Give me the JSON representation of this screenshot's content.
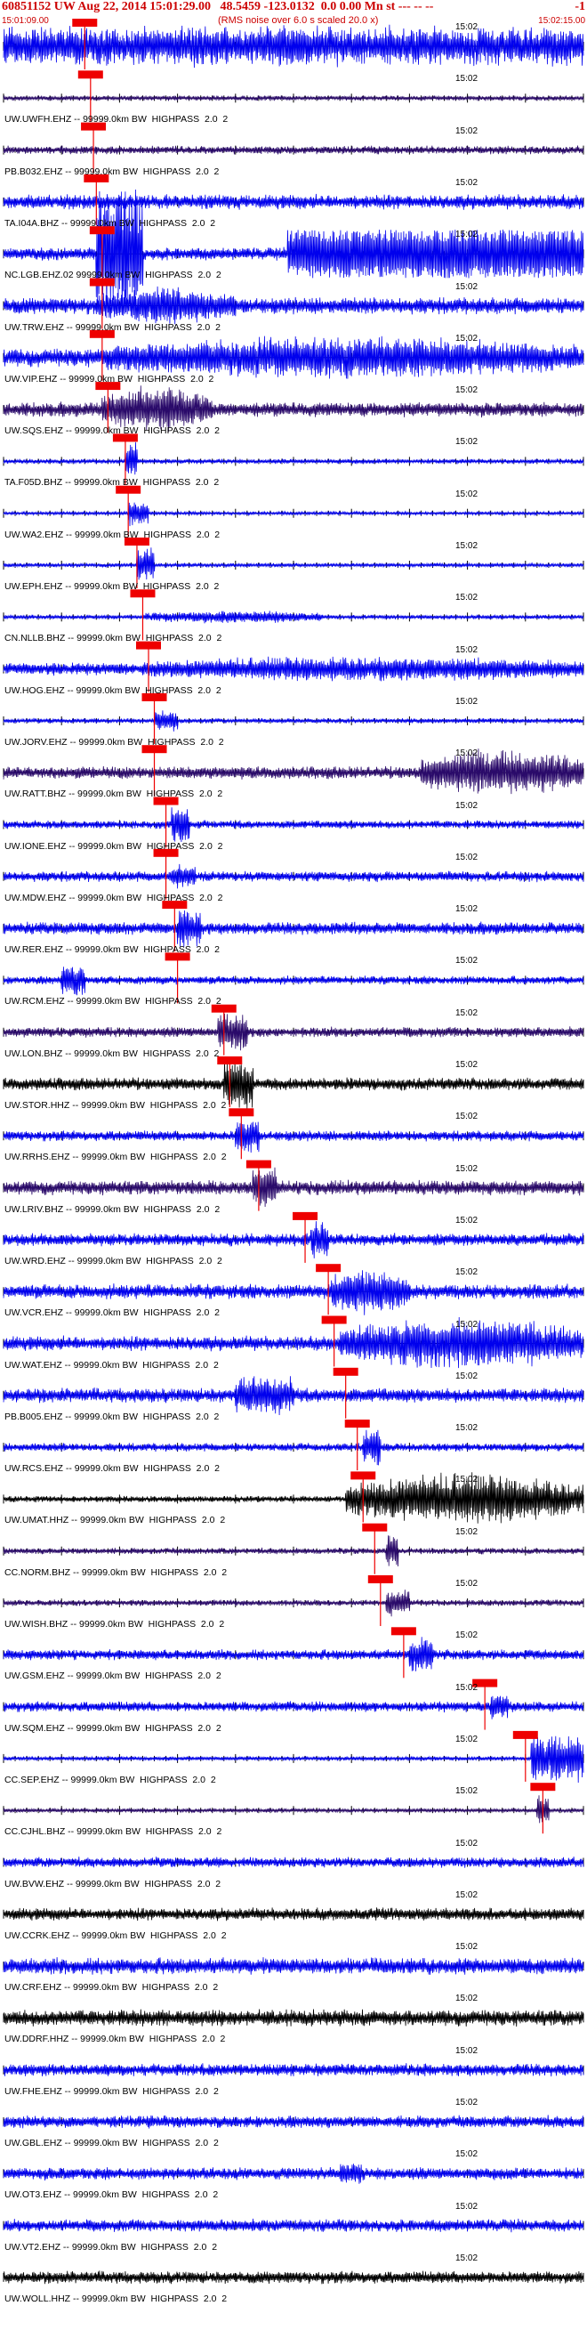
{
  "header": {
    "title": "60851152 UW Aug 22, 2014 15:01:29.00   48.5459 -123.0132  0.0 0.00 Mn st --- -- --",
    "event_suffix": "-1",
    "subtitle": "(RMS noise over 6.0 s scaled 20.0 x)",
    "start_time": "15:01:09.00",
    "end_time": "15:02:15.00",
    "time_mark": "15:02"
  },
  "colors": {
    "header_text": "#cc0000",
    "blue_trace": "#0000ee",
    "purple_trace": "#2a0a6a",
    "black_trace": "#000000",
    "pick_box": "#ee0000",
    "axis": "#000000"
  },
  "chart_data": {
    "type": "line",
    "title": "60851152 UW Aug 22, 2014 15:01:29.00",
    "x_range": [
      "15:01:09.00",
      "15:02:15.00"
    ],
    "time_mark": "15:02",
    "series": [
      {
        "label": "",
        "color": "blue",
        "amp": 0.95,
        "pick": 0.14,
        "burst": [
          0.43,
          0.55,
          1.0
        ]
      },
      {
        "label": "UW.UWFH.EHZ -- 99999.0km BW  HIGHPASS  2.0  2",
        "color": "purple",
        "amp": 0.12,
        "pick": 0.15,
        "burst": null
      },
      {
        "label": "PB.B032.EHZ -- 99999.0km BW  HIGHPASS  2.0  2",
        "color": "purple",
        "amp": 0.2,
        "pick": 0.155,
        "burst": null
      },
      {
        "label": "TA.I04A.BHZ -- 99999.0km BW  HIGHPASS  2.0  2",
        "color": "blue",
        "amp": 0.35,
        "pick": 0.16,
        "burst": null
      },
      {
        "label": "NC.LGB.EHZ.02 99999.0km BW  HIGHPASS  2.0  2",
        "color": "blue",
        "amp": 0.3,
        "pick": 0.17,
        "burst": [
          0.16,
          0.24,
          3.0
        ],
        "clip": [
          0.49,
          1.0
        ]
      },
      {
        "label": "UW.TRW.EHZ -- 99999.0km BW  HIGHPASS  2.0  2",
        "color": "blue",
        "amp": 0.4,
        "pick": 0.17,
        "burst": [
          0.16,
          0.4,
          0.9
        ]
      },
      {
        "label": "UW.VIP.EHZ -- 99999.0km BW  HIGHPASS  2.0  2",
        "color": "blue",
        "amp": 0.45,
        "pick": 0.17,
        "burst": [
          0.17,
          1.0,
          1.0
        ]
      },
      {
        "label": "UW.SQS.EHZ -- 99999.0km BW  HIGHPASS  2.0  2",
        "color": "purple",
        "amp": 0.35,
        "pick": 0.18,
        "burst": [
          0.17,
          0.36,
          1.1
        ]
      },
      {
        "label": "TA.F05D.BHZ -- 99999.0km BW  HIGHPASS  2.0  2",
        "color": "blue",
        "amp": 0.12,
        "pick": 0.21,
        "burst": [
          0.21,
          0.23,
          0.9
        ]
      },
      {
        "label": "UW.WA2.EHZ -- 99999.0km BW  HIGHPASS  2.0  2",
        "color": "blue",
        "amp": 0.08,
        "pick": 0.215,
        "burst": [
          0.215,
          0.25,
          0.6
        ]
      },
      {
        "label": "UW.EPH.EHZ -- 99999.0km BW  HIGHPASS  2.0  2",
        "color": "blue",
        "amp": 0.1,
        "pick": 0.23,
        "burst": [
          0.23,
          0.26,
          0.8
        ]
      },
      {
        "label": "CN.NLLB.BHZ -- 99999.0km BW  HIGHPASS  2.0  2",
        "color": "blue",
        "amp": 0.1,
        "pick": 0.24,
        "burst": [
          0.24,
          0.55,
          0.3
        ]
      },
      {
        "label": "UW.HOG.EHZ -- 99999.0km BW  HIGHPASS  2.0  2",
        "color": "blue",
        "amp": 0.3,
        "pick": 0.25,
        "burst": [
          0.24,
          1.0,
          0.6
        ]
      },
      {
        "label": "UW.JORV.EHZ -- 99999.0km BW  HIGHPASS  2.0  2",
        "color": "blue",
        "amp": 0.12,
        "pick": 0.26,
        "burst": [
          0.26,
          0.3,
          0.5
        ]
      },
      {
        "label": "UW.RATT.BHZ -- 99999.0km BW  HIGHPASS  2.0  2",
        "color": "purple",
        "amp": 0.3,
        "pick": 0.26,
        "burst": [
          0.72,
          1.0,
          1.1
        ]
      },
      {
        "label": "UW.IONE.EHZ -- 99999.0km BW  HIGHPASS  2.0  2",
        "color": "blue",
        "amp": 0.2,
        "pick": 0.28,
        "burst": [
          0.29,
          0.32,
          0.9
        ]
      },
      {
        "label": "UW.MDW.EHZ -- 99999.0km BW  HIGHPASS  2.0  2",
        "color": "blue",
        "amp": 0.25,
        "pick": 0.28,
        "burst": [
          0.29,
          0.33,
          0.6
        ]
      },
      {
        "label": "UW.RER.EHZ -- 99999.0km BW  HIGHPASS  2.0  2",
        "color": "blue",
        "amp": 0.3,
        "pick": 0.295,
        "burst": [
          0.3,
          0.34,
          0.9
        ]
      },
      {
        "label": "UW.RCM.EHZ -- 99999.0km BW  HIGHPASS  2.0  2",
        "color": "blue",
        "amp": 0.2,
        "pick": 0.3,
        "burst": [
          0.1,
          0.14,
          0.8
        ]
      },
      {
        "label": "UW.LON.BHZ -- 99999.0km BW  HIGHPASS  2.0  2",
        "color": "purple",
        "amp": 0.25,
        "pick": 0.38,
        "burst": [
          0.37,
          0.42,
          0.9
        ]
      },
      {
        "label": "UW.STOR.HHZ -- 99999.0km BW  HIGHPASS  2.0  2",
        "color": "black",
        "amp": 0.3,
        "pick": 0.39,
        "burst": [
          0.38,
          0.43,
          1.2
        ]
      },
      {
        "label": "UW.RRHS.EHZ -- 99999.0km BW  HIGHPASS  2.0  2",
        "color": "blue",
        "amp": 0.25,
        "pick": 0.41,
        "burst": [
          0.4,
          0.44,
          0.9
        ]
      },
      {
        "label": "UW.LRIV.BHZ -- 99999.0km BW  HIGHPASS  2.0  2",
        "color": "purple",
        "amp": 0.35,
        "pick": 0.44,
        "burst": [
          0.43,
          0.47,
          1.0
        ]
      },
      {
        "label": "UW.WRD.EHZ -- 99999.0km BW  HIGHPASS  2.0  2",
        "color": "blue",
        "amp": 0.3,
        "pick": 0.52,
        "burst": [
          0.53,
          0.56,
          0.9
        ]
      },
      {
        "label": "UW.VCR.EHZ -- 99999.0km BW  HIGHPASS  2.0  2",
        "color": "blue",
        "amp": 0.35,
        "pick": 0.56,
        "burst": [
          0.56,
          0.7,
          1.1
        ]
      },
      {
        "label": "UW.WAT.EHZ -- 99999.0km BW  HIGHPASS  2.0  2",
        "color": "blue",
        "amp": 0.35,
        "pick": 0.57,
        "burst": [
          0.58,
          1.0,
          1.2
        ]
      },
      {
        "label": "PB.B005.EHZ -- 99999.0km BW  HIGHPASS  2.0  2",
        "color": "blue",
        "amp": 0.35,
        "pick": 0.59,
        "burst": [
          0.4,
          0.5,
          0.9
        ]
      },
      {
        "label": "UW.RCS.EHZ -- 99999.0km BW  HIGHPASS  2.0  2",
        "color": "blue",
        "amp": 0.2,
        "pick": 0.61,
        "burst": [
          0.62,
          0.65,
          0.9
        ]
      },
      {
        "label": "UW.UMAT.HHZ -- 99999.0km BW  HIGHPASS  2.0  2",
        "color": "black",
        "amp": 0.15,
        "pick": 0.62,
        "burst": [
          0.59,
          1.0,
          1.2
        ]
      },
      {
        "label": "CC.NORM.BHZ -- 99999.0km BW  HIGHPASS  2.0  2",
        "color": "purple",
        "amp": 0.15,
        "pick": 0.64,
        "burst": [
          0.66,
          0.68,
          0.8
        ]
      },
      {
        "label": "UW.WISH.BHZ -- 99999.0km BW  HIGHPASS  2.0  2",
        "color": "purple",
        "amp": 0.15,
        "pick": 0.65,
        "burst": [
          0.66,
          0.7,
          0.6
        ]
      },
      {
        "label": "UW.GSM.EHZ -- 99999.0km BW  HIGHPASS  2.0  2",
        "color": "blue",
        "amp": 0.25,
        "pick": 0.69,
        "burst": [
          0.7,
          0.74,
          0.8
        ]
      },
      {
        "label": "UW.SQM.EHZ -- 99999.0km BW  HIGHPASS  2.0  2",
        "color": "blue",
        "amp": 0.25,
        "pick": 0.83,
        "burst": [
          0.84,
          0.87,
          0.6
        ]
      },
      {
        "label": "CC.SEP.EHZ -- 99999.0km BW  HIGHPASS  2.0  2",
        "color": "blue",
        "amp": 0.1,
        "pick": 0.9,
        "burst": [
          0.91,
          1.0,
          1.1
        ]
      },
      {
        "label": "CC.CJHL.BHZ -- 99999.0km BW  HIGHPASS  2.0  2",
        "color": "purple",
        "amp": 0.1,
        "pick": 0.93,
        "burst": [
          0.92,
          0.94,
          0.7
        ]
      },
      {
        "label": "UW.BVW.EHZ -- 99999.0km BW  HIGHPASS  2.0  2",
        "color": "blue",
        "amp": 0.25,
        "pick": null,
        "burst": null
      },
      {
        "label": "UW.CCRK.EHZ -- 99999.0km BW  HIGHPASS  2.0  2",
        "color": "black",
        "amp": 0.3,
        "pick": null,
        "burst": null
      },
      {
        "label": "UW.CRF.EHZ -- 99999.0km BW  HIGHPASS  2.0  2",
        "color": "blue",
        "amp": 0.4,
        "pick": null,
        "burst": null
      },
      {
        "label": "UW.DDRF.HHZ -- 99999.0km BW  HIGHPASS  2.0  2",
        "color": "black",
        "amp": 0.4,
        "pick": null,
        "burst": null
      },
      {
        "label": "UW.FHE.EHZ -- 99999.0km BW  HIGHPASS  2.0  2",
        "color": "blue",
        "amp": 0.3,
        "pick": null,
        "burst": null
      },
      {
        "label": "UW.GBL.EHZ -- 99999.0km BW  HIGHPASS  2.0  2",
        "color": "blue",
        "amp": 0.3,
        "pick": null,
        "burst": null
      },
      {
        "label": "UW.OT3.EHZ -- 99999.0km BW  HIGHPASS  2.0  2",
        "color": "blue",
        "amp": 0.3,
        "pick": null,
        "burst": [
          0.58,
          0.62,
          0.5
        ]
      },
      {
        "label": "UW.VT2.EHZ -- 99999.0km BW  HIGHPASS  2.0  2",
        "color": "blue",
        "amp": 0.3,
        "pick": null,
        "burst": null
      },
      {
        "label": "UW.WOLL.HHZ -- 99999.0km BW  HIGHPASS  2.0  2",
        "color": "black",
        "amp": 0.3,
        "pick": null,
        "burst": null
      }
    ]
  }
}
